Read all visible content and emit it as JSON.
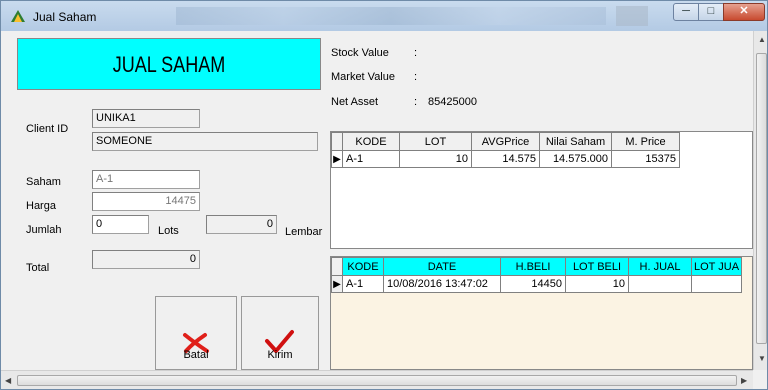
{
  "window": {
    "title": "Jual Saham"
  },
  "form": {
    "banner": "JUAL SAHAM",
    "client_id_label": "Client ID",
    "client_id": "UNIKA1",
    "client_name": "SOMEONE",
    "saham_label": "Saham",
    "saham": "A-1",
    "harga_label": "Harga",
    "harga": "14475",
    "jumlah_label": "Jumlah",
    "jumlah": "0",
    "lots_label": "Lots",
    "lembar_value": "0",
    "lembar_label": "Lembar",
    "total_label": "Total",
    "total": "0",
    "batal_label": "Batal",
    "kirim_label": "Kirim"
  },
  "summary": {
    "stock_value_label": "Stock Value",
    "stock_value_sep": ":",
    "market_value_label": "Market Value",
    "market_value_sep": ":",
    "net_asset_label": "Net Asset",
    "net_asset_sep": ":",
    "net_asset": "85425000"
  },
  "portfolio_grid": {
    "headers": [
      "KODE",
      "LOT",
      "AVGPrice",
      "Nilai Saham",
      "M. Price"
    ],
    "rows": [
      {
        "kode": "A-1",
        "lot": "10",
        "avg": "14.575",
        "nilai": "14.575.000",
        "mprice": "15375"
      }
    ]
  },
  "history_grid": {
    "headers": [
      "KODE",
      "DATE",
      "H.BELI",
      "LOT BELI",
      "H. JUAL",
      "LOT JUA"
    ],
    "rows": [
      {
        "kode": "A-1",
        "date": "10/08/2016 13:47:02",
        "hbeli": "14450",
        "lotbeli": "10",
        "hjual": "",
        "lotjual": ""
      }
    ]
  },
  "icons": {
    "close": "close-icon",
    "minimize": "minimize-icon",
    "maximize": "maximize-icon",
    "cancel": "x-icon",
    "send": "checkmark-icon"
  },
  "colors": {
    "banner": "#00ffff",
    "history_header": "#00ffff",
    "cancel_icon": "#e0201a",
    "send_icon": "#d01010"
  }
}
